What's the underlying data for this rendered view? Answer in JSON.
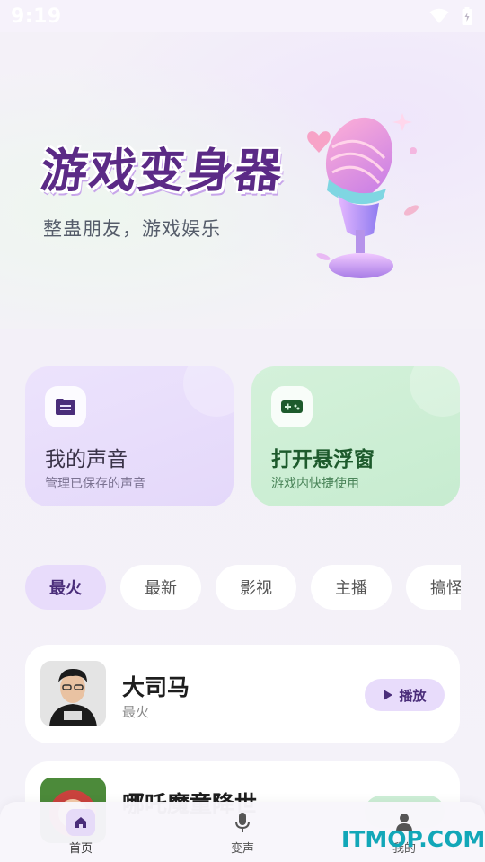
{
  "status_bar": {
    "time": "9:19"
  },
  "hero": {
    "title": "游戏变身器",
    "subtitle": "整蛊朋友，游戏娱乐"
  },
  "cards": [
    {
      "title": "我的声音",
      "subtitle": "管理已保存的声音",
      "icon": "folder-icon"
    },
    {
      "title": "打开悬浮窗",
      "subtitle": "游戏内快捷使用",
      "icon": "gamepad-icon"
    }
  ],
  "tabs": [
    {
      "label": "最火",
      "active": true
    },
    {
      "label": "最新"
    },
    {
      "label": "影视"
    },
    {
      "label": "主播"
    },
    {
      "label": "搞怪"
    }
  ],
  "list": [
    {
      "name": "大司马",
      "tag": "最火",
      "play_label": "播放"
    },
    {
      "name": "哪吒魔童降世",
      "tag": "",
      "play_label": ""
    }
  ],
  "bottom_nav": [
    {
      "label": "首页",
      "icon": "home-icon",
      "active": true
    },
    {
      "label": "变声",
      "icon": "microphone-icon"
    },
    {
      "label": "我的",
      "icon": "person-icon"
    }
  ],
  "watermark": "ITMOP.COM",
  "colors": {
    "primary_purple": "#e8dcfb",
    "primary_purple_text": "#4a2d7a",
    "green_card": "#c7ecd0",
    "green_text": "#1d5a2c",
    "watermark": "#12a7b8"
  }
}
